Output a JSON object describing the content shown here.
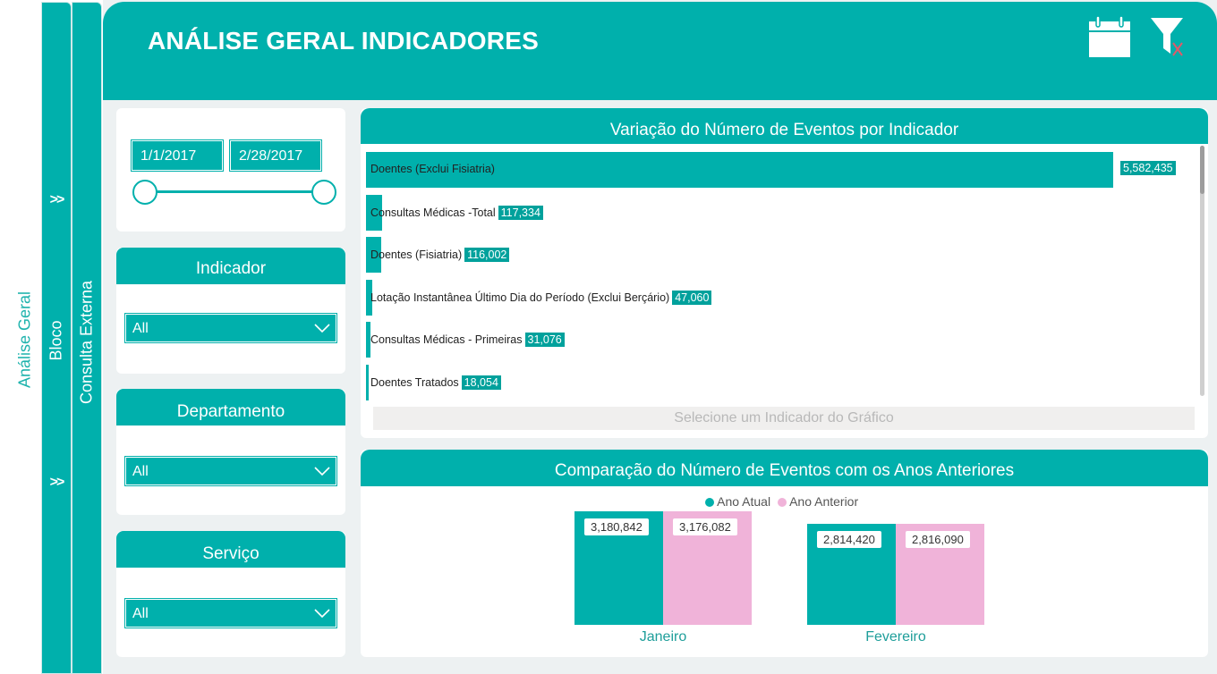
{
  "nav": {
    "analise_geral": "Análise Geral",
    "bloco": "Bloco",
    "consulta_externa": "Consulta Externa",
    "expand_1": ">>",
    "expand_2": ">>"
  },
  "header": {
    "title": "ANÁLISE GERAL INDICADORES",
    "calendar_icon": "calendar-icon",
    "clear_filter_icon": "filter-clear-icon"
  },
  "date_filter": {
    "start": "1/1/2017",
    "end": "2/28/2017"
  },
  "slicers": {
    "indicador": {
      "title": "Indicador",
      "value": "All"
    },
    "departamento": {
      "title": "Departamento",
      "value": "All"
    },
    "servico": {
      "title": "Serviço",
      "value": "All"
    }
  },
  "bar_chart": {
    "title": "Variação do Número de Eventos por Indicador",
    "hint": "Selecione um Indicador do Gráfico",
    "labels": [
      "Doentes (Exclui Fisiatria)",
      "Consultas Médicas -Total",
      "Doentes (Fisiatria)",
      "Lotação Instantânea Último Dia do Período (Exclui Berçário)",
      "Consultas Médicas - Primeiras",
      "Doentes Tratados"
    ],
    "value_labels": [
      "5,582,435",
      "117,334",
      "116,002",
      "47,060",
      "31,076",
      "18,054"
    ]
  },
  "column_chart": {
    "title": "Comparação do Número de Eventos com os Anos Anteriores",
    "legend": [
      "Ano Atual",
      "Ano Anterior"
    ],
    "categories": [
      "Janeiro",
      "Fevereiro"
    ],
    "value_labels": {
      "atual": [
        "3,180,842",
        "2,814,420"
      ],
      "anterior": [
        "3,176,082",
        "2,816,090"
      ]
    }
  },
  "colors": {
    "accent": "#00b0ac",
    "anterior": "#f0b3d9",
    "background": "#edf1f2"
  },
  "chart_data": [
    {
      "type": "bar",
      "title": "Variação do Número de Eventos por Indicador",
      "categories": [
        "Doentes (Exclui Fisiatria)",
        "Consultas Médicas -Total",
        "Doentes (Fisiatria)",
        "Lotação Instantânea Último Dia do Período (Exclui Berçário)",
        "Consultas Médicas - Primeiras",
        "Doentes Tratados"
      ],
      "values": [
        5582435,
        117334,
        116002,
        47060,
        31076,
        18054
      ],
      "orientation": "horizontal",
      "grid": false
    },
    {
      "type": "bar",
      "title": "Comparação do Número de Eventos com os Anos Anteriores",
      "categories": [
        "Janeiro",
        "Fevereiro"
      ],
      "series": [
        {
          "name": "Ano Atual",
          "values": [
            3180842,
            2814420
          ]
        },
        {
          "name": "Ano Anterior",
          "values": [
            3176082,
            2816090
          ]
        }
      ],
      "legend": "top-center",
      "grid": false
    }
  ]
}
